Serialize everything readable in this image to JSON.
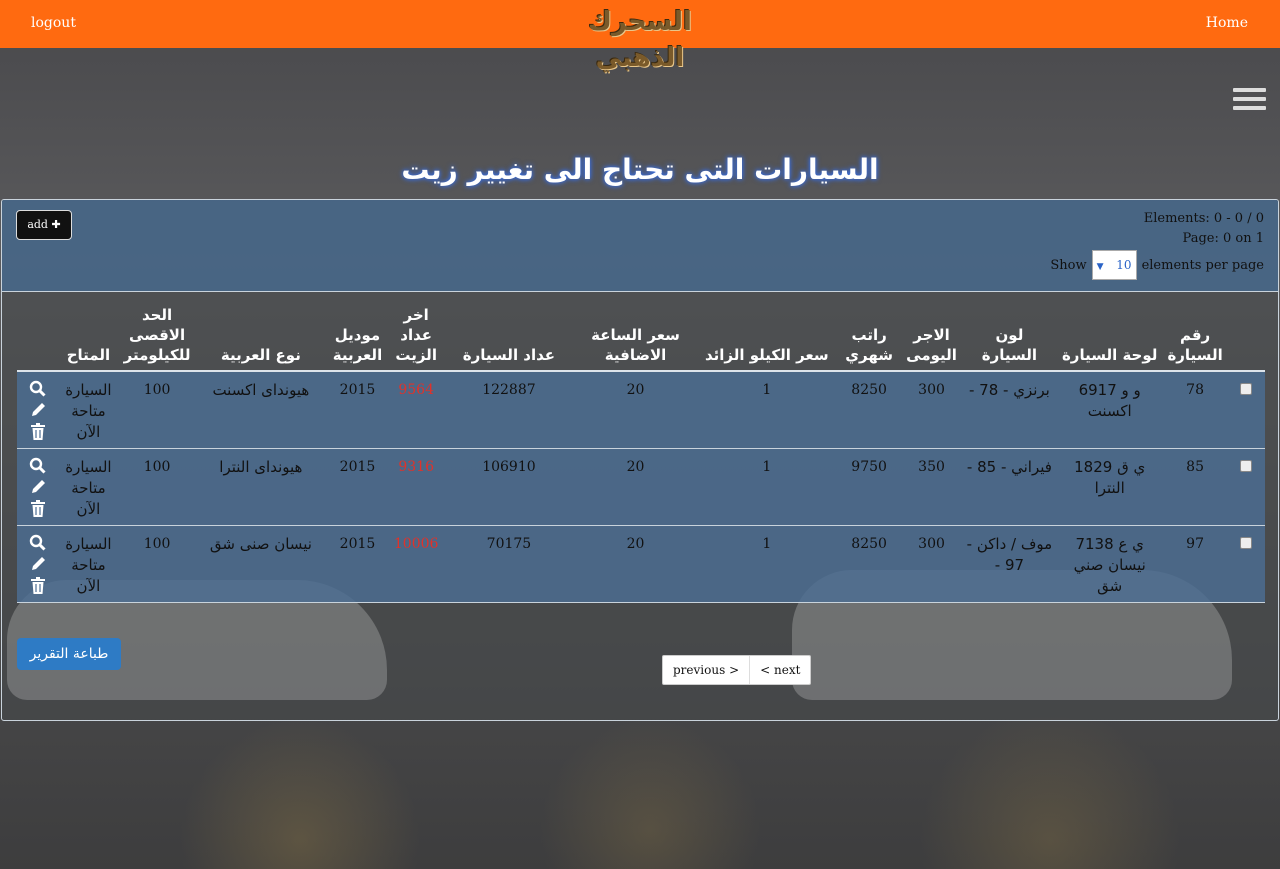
{
  "topbar": {
    "logout": "logout",
    "home": "Home",
    "logo_text": "السحرك الذهبي"
  },
  "page": {
    "title": "السيارات التى تحتاج الى تغيير زيت"
  },
  "toolbar": {
    "add_label": "add",
    "elements": "Elements: 0 - 0 / 0",
    "page": "Page: 0 on 1",
    "show_label": "Show",
    "per_page_value": "10",
    "per_page_suffix": "elements per page"
  },
  "table": {
    "headers": [
      "رقم السيارة",
      "لوحة السيارة",
      "لون السيارة",
      "الاجر اليومى",
      "راتب شهري",
      "سعر الكيلو الزائد",
      "سعر الساعة الاضافية",
      "عداد السيارة",
      "اخر عداد الزيت",
      "موديل العربية",
      "نوع العربية",
      "الحد الاقصى للكيلومتر",
      "المتاح"
    ],
    "rows": [
      {
        "num": "78",
        "plate": "و و 6917 اكسنت",
        "color": "برنزي - 78 -",
        "daily": "300",
        "monthly": "8250",
        "km_price": "1",
        "hour_price": "20",
        "odometer": "122887",
        "oil": "9564",
        "model": "2015",
        "type": "هيونداى اكسنت",
        "max_km": "100",
        "status": "السيارة متاحة الآن"
      },
      {
        "num": "85",
        "plate": "ي ق 1829 النترا",
        "color": "فيراني - 85 -",
        "daily": "350",
        "monthly": "9750",
        "km_price": "1",
        "hour_price": "20",
        "odometer": "106910",
        "oil": "9316",
        "model": "2015",
        "type": "هيونداى النترا",
        "max_km": "100",
        "status": "السيارة متاحة الآن"
      },
      {
        "num": "97",
        "plate": "ي ع 7138 نيسان صني شق",
        "color": "موف / داكن - 97 -",
        "daily": "300",
        "monthly": "8250",
        "km_price": "1",
        "hour_price": "20",
        "odometer": "70175",
        "oil": "10006",
        "model": "2015",
        "type": "نيسان صنى شق",
        "max_km": "100",
        "status": "السيارة متاحة الآن"
      }
    ]
  },
  "footer": {
    "print_label": "طباعة التقرير",
    "previous_label": "previous >",
    "next_label": "< next"
  },
  "colors": {
    "topbar": "#ff6a10",
    "row_bg": "#4c6e94",
    "oil_text": "#e0322a",
    "print_button": "#2e7bc5"
  }
}
